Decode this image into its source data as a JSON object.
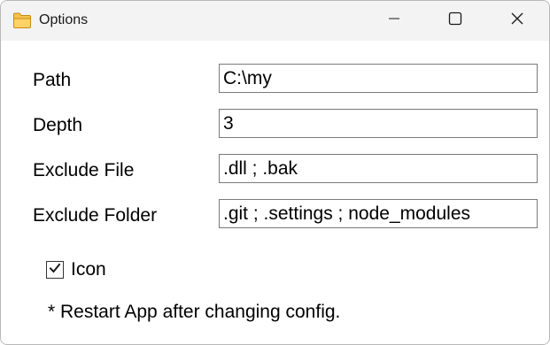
{
  "window": {
    "title": "Options",
    "title_icon": "folder-icon",
    "controls": {
      "minimize_icon": "minimize-icon",
      "maximize_icon": "maximize-icon",
      "close_icon": "close-icon"
    }
  },
  "form": {
    "path": {
      "label": "Path",
      "value": "C:\\my"
    },
    "depth": {
      "label": "Depth",
      "value": "3"
    },
    "exclude_file": {
      "label": "Exclude File",
      "value": ".dll ; .bak"
    },
    "exclude_folder": {
      "label": "Exclude Folder",
      "value": ".git ; .settings ; node_modules"
    },
    "icon_checkbox": {
      "label": "Icon",
      "checked": true
    },
    "note": "* Restart App after changing config."
  },
  "colors": {
    "titlebar_bg": "#f3f3f3",
    "folder_icon": "#e8b54a",
    "field_border": "#7a7a7a"
  }
}
